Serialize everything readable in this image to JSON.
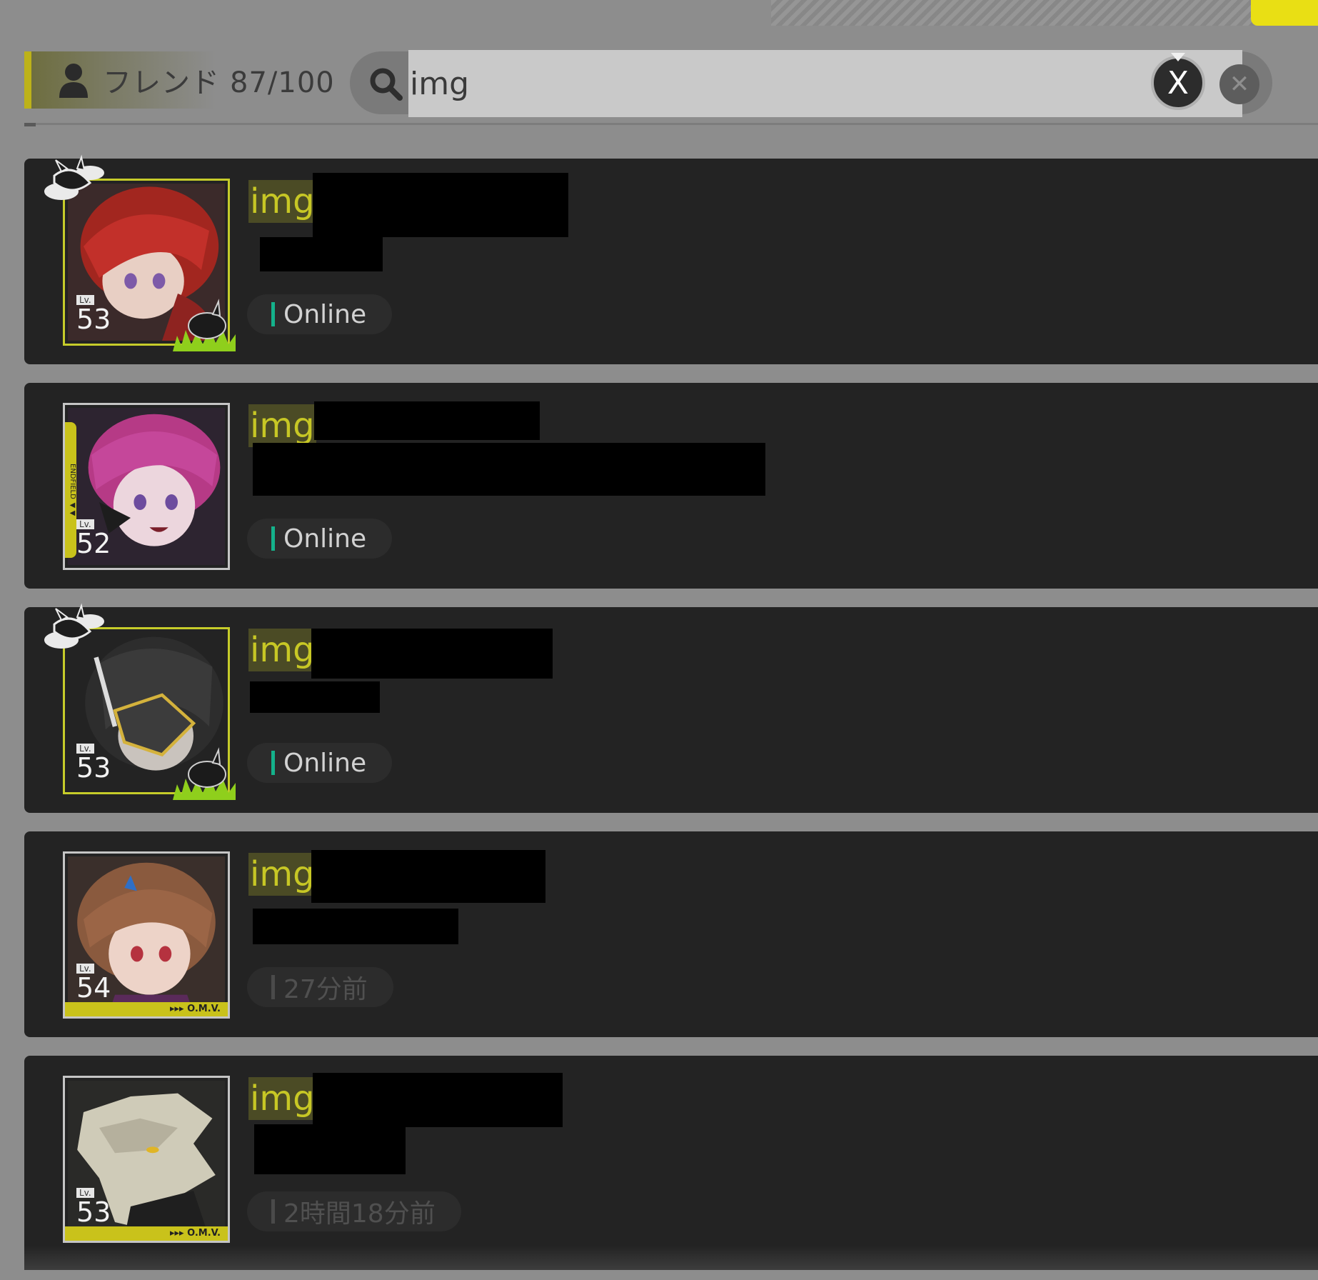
{
  "header": {
    "friend_label": "フレンド",
    "friend_count": "87/100"
  },
  "search": {
    "value": "img",
    "placeholder": ""
  },
  "friends": [
    {
      "name": "img",
      "level": "53",
      "level_prefix": "Lv.",
      "status": "Online",
      "online": true,
      "badge": "cat-cloud",
      "frame": "highlight",
      "portrait": "red-hair"
    },
    {
      "name": "img",
      "level": "52",
      "level_prefix": "Lv.",
      "status": "Online",
      "online": true,
      "badge": "none",
      "frame": "endfield",
      "strip_text": "ENDFIELD ◀◀",
      "portrait": "pink-hair"
    },
    {
      "name": "img",
      "level": "53",
      "level_prefix": "Lv.",
      "status": "Online",
      "online": true,
      "badge": "cat-cloud",
      "frame": "highlight",
      "portrait": "black-hair-mask"
    },
    {
      "name": "img",
      "level": "54",
      "level_prefix": "Lv.",
      "status": "27分前",
      "online": false,
      "badge": "none",
      "frame": "omv",
      "strip_text": "▸▸▸ O.M.V.",
      "portrait": "brown-hair"
    },
    {
      "name": "img",
      "level": "53",
      "level_prefix": "Lv.",
      "status": "2時間18分前",
      "online": false,
      "badge": "none",
      "frame": "omv",
      "strip_text": "▸▸▸ O.M.V.",
      "portrait": "white-dragon"
    }
  ],
  "colors": {
    "accent_yellow": "#c7c725",
    "online_green": "#14b28b",
    "card_bg": "#232323"
  }
}
